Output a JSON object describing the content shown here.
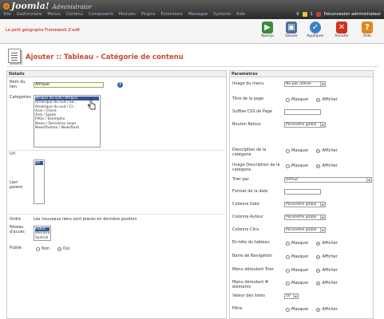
{
  "topbar": {
    "brand": "Joomla!",
    "subtitle": "Administrator",
    "menu": [
      "Site",
      "Gestionnaire",
      "Menus",
      "Contenu",
      "Composants",
      "Modules",
      "Plugins",
      "Extensions",
      "Messages",
      "Système",
      "Aide"
    ],
    "status_counts": [
      "0",
      "1"
    ],
    "logout": "Déconnexion administrateur"
  },
  "toolbar": {
    "site_name": "Le petit géographe Framework Z-edit",
    "buttons": [
      {
        "label": "Aperçu",
        "icon": "preview-icon",
        "color": "#3a8a3a"
      },
      {
        "label": "Sauver",
        "icon": "save-icon",
        "color": "#4a6fa0"
      },
      {
        "label": "Appliquer",
        "icon": "apply-icon",
        "color": "#3b7fc4"
      },
      {
        "label": "Annuler",
        "icon": "cancel-icon",
        "color": "#d03018"
      },
      {
        "label": "Aide",
        "icon": "help-icon",
        "color": "#e08820"
      }
    ]
  },
  "header": {
    "title": "Ajouter :: Tableau - Catégorie de contenu"
  },
  "details": {
    "heading": "Détails",
    "name_label": "Nom du lien",
    "name_value": "Afrique",
    "categories_label": "Catégories",
    "categories": [
      "Afrique du sud / Afrique",
      "Amérique du sud / Sa...",
      "Amérique du sud / Cr...",
      "Asie / Chine",
      "Asie / Japon",
      "FAQs / Exemples",
      "News / Dernières news",
      "Newsflashes / Newsflash"
    ],
    "url_label": "Url",
    "url_options": [
      "Url"
    ],
    "parent_label": "Lien parent",
    "order_label": "Ordre",
    "order_text": "Les nouveaux liens sont placés en dernière position",
    "access_label": "Niveau d'accès",
    "access_options": [
      "Public",
      "Membre",
      "Spécial"
    ],
    "published_label": "Publié",
    "published_no": "Non",
    "published_yes": "Oui"
  },
  "params": {
    "heading": "Paramètres",
    "rows": [
      {
        "label": "Image du menu",
        "type": "dropdown",
        "value": "Ne pas utiliser"
      },
      {
        "label": "Titre de la page",
        "type": "radio",
        "no": "Masquer",
        "yes": "Afficher",
        "selected": "yes"
      },
      {
        "label": "Suffixe CSS de Page",
        "type": "input",
        "value": ""
      },
      {
        "label": "Bouton Retour",
        "type": "dropdown",
        "value": "Paramètre global"
      },
      {
        "label": "Description de la catégorie",
        "type": "radio",
        "no": "Masquer",
        "yes": "Afficher",
        "selected": "yes"
      },
      {
        "label": "Image Description de la catégorie",
        "type": "radio",
        "no": "Masquer",
        "yes": "Afficher",
        "selected": "yes"
      },
      {
        "label": "Trier par",
        "type": "dropdown-wide",
        "value": "Défaut"
      },
      {
        "label": "Format de la date",
        "type": "input",
        "value": ""
      },
      {
        "label": "Colonne Date",
        "type": "dropdown",
        "value": "Paramètre global"
      },
      {
        "label": "Colonne Auteur",
        "type": "dropdown",
        "value": "Paramètre global"
      },
      {
        "label": "Colonne Clics",
        "type": "dropdown",
        "value": "Paramètre global"
      },
      {
        "label": "En-tête du tableau",
        "type": "radio",
        "no": "Masquer",
        "yes": "Afficher",
        "selected": "yes"
      },
      {
        "label": "Barre de Navigation",
        "type": "radio",
        "no": "Masquer",
        "yes": "Afficher",
        "selected": "yes"
      },
      {
        "label": "Menu déroulant Trier",
        "type": "radio",
        "no": "Masquer",
        "yes": "Afficher",
        "selected": "yes"
      },
      {
        "label": "Menu déroulant # éléments",
        "type": "radio",
        "no": "Masquer",
        "yes": "Afficher",
        "selected": "yes"
      },
      {
        "label": "Valeur des listes",
        "type": "small-dropdown",
        "value": "50"
      },
      {
        "label": "Filtre",
        "type": "radio",
        "no": "Masquer",
        "yes": "Afficher",
        "selected": "yes"
      }
    ]
  }
}
